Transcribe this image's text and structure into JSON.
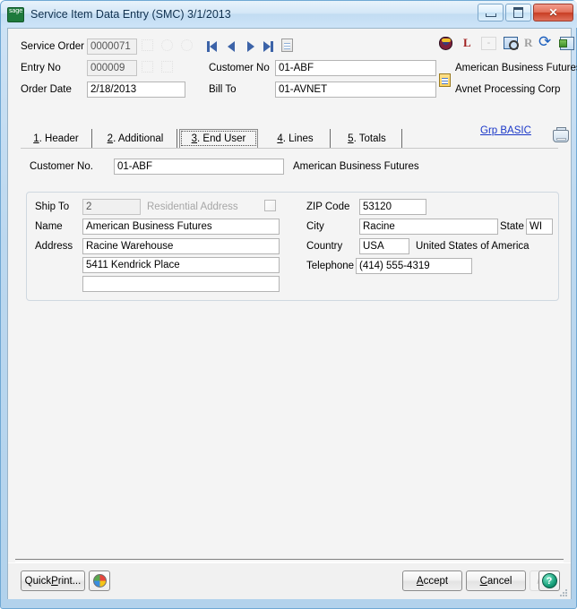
{
  "window": {
    "title": "Service Item Data Entry (SMC) 3/1/2013",
    "app_icon": "sage-logo-icon",
    "controls": {
      "minimize": "minimize-icon",
      "restore": "restore-icon",
      "close": "close-icon"
    }
  },
  "header": {
    "service_order_label": "Service Order",
    "service_order_value": "0000071",
    "entry_no_label": "Entry No",
    "entry_no_value": "000009",
    "order_date_label": "Order Date",
    "order_date_value": "2/18/2013",
    "customer_no_label": "Customer No",
    "customer_no_value": "01-ABF",
    "customer_name": "American Business Futures",
    "bill_to_label": "Bill To",
    "bill_to_value": "01-AVNET",
    "bill_to_name": "Avnet Processing Corp",
    "nav": {
      "first": "first-record-icon",
      "previous": "previous-record-icon",
      "next": "next-record-icon",
      "last": "last-record-icon",
      "memo": "memo-icon"
    },
    "toolbar": {
      "owl": "owl-icon",
      "letter_l": "L",
      "dash": "-",
      "inquiry": "inquiry-icon",
      "letter_r": "R",
      "refresh": "refresh-icon",
      "export": "export-icon"
    }
  },
  "tabs": [
    {
      "accel": "1",
      "label": ". Header",
      "active": false
    },
    {
      "accel": "2",
      "label": ". Additional",
      "active": false
    },
    {
      "accel": "3",
      "label": ". End User",
      "active": true
    },
    {
      "accel": "4",
      "label": ". Lines",
      "active": false
    },
    {
      "accel": "5",
      "label": ". Totals",
      "active": false
    }
  ],
  "grp_link": {
    "label": "Grp BASIC",
    "printer_icon": "printer-icon"
  },
  "main": {
    "customer_no_label": "Customer No.",
    "customer_no_value": "01-ABF",
    "customer_name": "American Business Futures",
    "ship_to_label": "Ship To",
    "ship_to_value": "2",
    "residential_label": "Residential Address",
    "residential_checked": false,
    "name_label": "Name",
    "name_value": "American Business Futures",
    "address_label": "Address",
    "address_line1": "Racine Warehouse",
    "address_line2": "5411 Kendrick Place",
    "address_line3": "",
    "zip_label": "ZIP Code",
    "zip_value": "53120",
    "city_label": "City",
    "city_value": "Racine",
    "state_label": "State",
    "state_value": "WI",
    "country_label": "Country",
    "country_value": "USA",
    "country_name": "United States of America",
    "telephone_label": "Telephone",
    "telephone_value": "(414) 555-4319"
  },
  "footer": {
    "quick_print_prefix": "Quick",
    "quick_print_accel": "P",
    "quick_print_suffix": "rint...",
    "quick_print_full": "Quick Print...",
    "print_icon": "pinwheel-print-icon",
    "accept_accel": "A",
    "accept_label": "ccept",
    "cancel_accel": "C",
    "cancel_label": "ancel",
    "delete_label": "/-",
    "help_label": "?"
  },
  "colors": {
    "accent_blue": "#3c63a8",
    "link_blue": "#1a37c8",
    "titlebar": "#cde4f8",
    "close_red": "#c83d23",
    "help_green": "#17a07a"
  }
}
